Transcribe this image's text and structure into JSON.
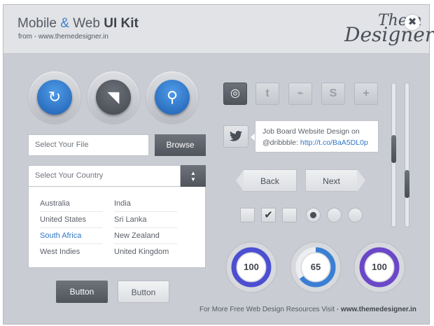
{
  "header": {
    "title_part1": "Mobile ",
    "title_amp": "&",
    "title_part2": " Web ",
    "title_bold": "UI Kit",
    "subtitle": "from - www.themedesigner.in",
    "logo_line1": "Them",
    "logo_line2": "Designer",
    "close_icon": "✖"
  },
  "icons": {
    "refresh": "↻",
    "megaphone": "◥",
    "search": "⚲"
  },
  "file": {
    "placeholder": "Select Your File",
    "browse_label": "Browse"
  },
  "country": {
    "placeholder": "Select Your Country",
    "arrow_up": "▲",
    "arrow_down": "▼",
    "col1": [
      "Australia",
      "United States",
      "South Africa",
      "West Indies"
    ],
    "col2": [
      "India",
      "Sri Lanka",
      "New Zealand",
      "United Kingdom"
    ],
    "selected": "South Africa"
  },
  "buttons": {
    "dark_label": "Button",
    "light_label": "Button"
  },
  "social": {
    "dribbble": "◎",
    "twitter": "t",
    "rss": "⌁",
    "skype": "S",
    "plus": "+"
  },
  "tweet": {
    "line1": "Job Board Website Design on",
    "handle": "@dribbble: ",
    "link": "http://t.co/BaA5DL0p"
  },
  "nav": {
    "back_label": "Back",
    "next_label": "Next"
  },
  "checks": {
    "check_mark": "✔"
  },
  "gauges": [
    {
      "value": "100",
      "progress": 1.0,
      "color": "#4c4fd1"
    },
    {
      "value": "65",
      "progress": 0.65,
      "color": "#3a7fd4"
    },
    {
      "value": "100",
      "progress": 1.0,
      "color": "#6a48c8"
    }
  ],
  "sliders": [
    {
      "value": 0.45
    },
    {
      "value": 0.75
    }
  ],
  "footer": {
    "text": "For More Free Web Design Resources Visit - ",
    "site": "www.themedesigner.in"
  }
}
